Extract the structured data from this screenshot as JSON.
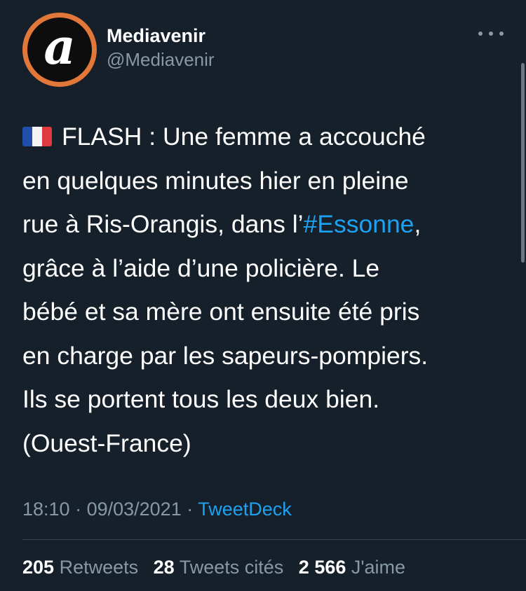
{
  "account": {
    "display_name": "Mediavenir",
    "handle": "@Mediavenir",
    "avatar_letter": "a",
    "avatar_ring_color": "#e2773a"
  },
  "tweet": {
    "flag_icon": "flag-france-icon",
    "lines": [
      {
        "before": "FLASH : Une femme a accouché"
      },
      {
        "before": "en quelques minutes hier en pleine"
      },
      {
        "before": "rue à Ris-Orangis, dans l’",
        "hashtag": "#Essonne",
        "after": ","
      },
      {
        "before": "grâce à l’aide d’une policière. Le"
      },
      {
        "before": "bébé et sa mère ont ensuite été pris"
      },
      {
        "before": "en charge par les sapeurs-pompiers."
      },
      {
        "before": "Ils se portent tous les deux bien."
      },
      {
        "before": "(Ouest-France)"
      }
    ]
  },
  "meta": {
    "time": "18:10",
    "separator": " · ",
    "date": "09/03/2021",
    "source": "TweetDeck"
  },
  "stats": {
    "retweets_count": "205",
    "retweets_label": "Retweets",
    "quotes_count": "28",
    "quotes_label": "Tweets cités",
    "likes_count": "2 566",
    "likes_label": "J'aime"
  },
  "colors": {
    "background": "#15202b",
    "link": "#1da1f2",
    "secondary_text": "#8899a6"
  }
}
